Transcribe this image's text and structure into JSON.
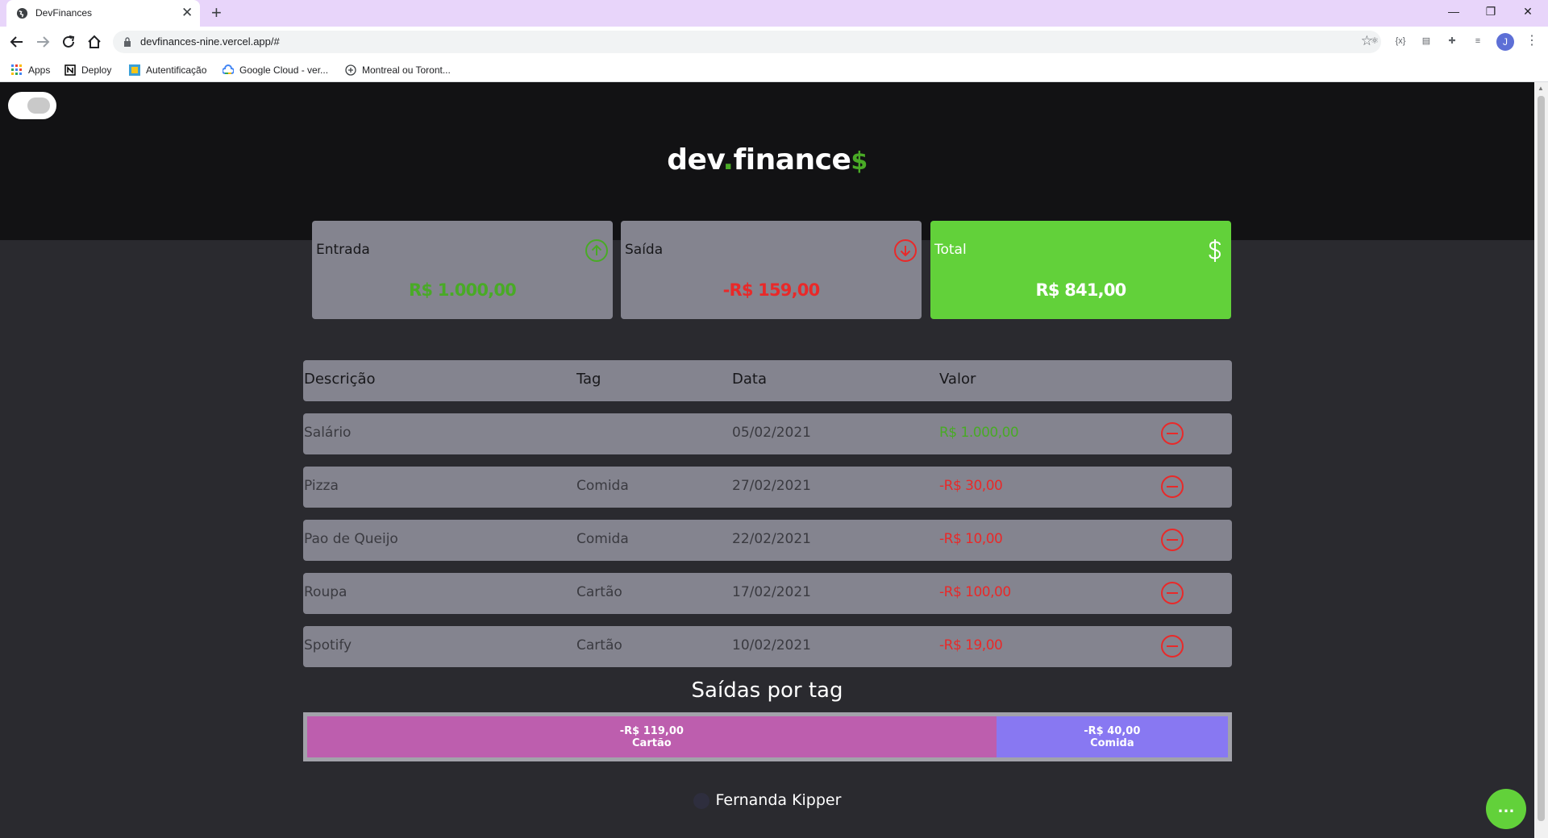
{
  "browser": {
    "tab_title": "DevFinances",
    "url": "devfinances-nine.vercel.app/#",
    "profile_initial": "J",
    "bookmarks": [
      {
        "label": "Apps",
        "icon": "apps-grid-icon"
      },
      {
        "label": "Deploy",
        "icon": "notion-icon"
      },
      {
        "label": "Autentificação",
        "icon": "bookmark-image-icon"
      },
      {
        "label": "Google Cloud - ver...",
        "icon": "google-cloud-icon"
      },
      {
        "label": "Montreal ou Toront...",
        "icon": "globe-plus-icon"
      }
    ]
  },
  "header": {
    "logo_main": "dev",
    "logo_dot": ".",
    "logo_rest": "finance",
    "logo_dollar": "$"
  },
  "cards": [
    {
      "label": "Entrada",
      "value": "R$ 1.000,00",
      "icon": "arrow-up-circle-icon",
      "value_color": "#49aa26"
    },
    {
      "label": "Saída",
      "value": "-R$ 159,00",
      "icon": "arrow-down-circle-icon",
      "value_color": "#e92929"
    },
    {
      "label": "Total",
      "value": "R$ 841,00",
      "icon": "dollar-icon",
      "value_color": "#ffffff"
    }
  ],
  "table": {
    "headers": [
      "Descrição",
      "Tag",
      "Data",
      "Valor"
    ],
    "rows": [
      {
        "description": "Salário",
        "tag": "",
        "date": "05/02/2021",
        "amount": "R$ 1.000,00",
        "kind": "income"
      },
      {
        "description": "Pizza",
        "tag": "Comida",
        "date": "27/02/2021",
        "amount": "-R$ 30,00",
        "kind": "expense"
      },
      {
        "description": "Pao de Queijo",
        "tag": "Comida",
        "date": "22/02/2021",
        "amount": "-R$ 10,00",
        "kind": "expense"
      },
      {
        "description": "Roupa",
        "tag": "Cartão",
        "date": "17/02/2021",
        "amount": "-R$ 100,00",
        "kind": "expense"
      },
      {
        "description": "Spotify",
        "tag": "Cartão",
        "date": "10/02/2021",
        "amount": "-R$ 19,00",
        "kind": "expense"
      }
    ]
  },
  "tag_summary": {
    "title": "Saídas por tag",
    "segments": [
      {
        "amount": "-R$ 119,00",
        "tag": "Cartão",
        "color": "#bd5eae",
        "share": 119
      },
      {
        "amount": "-R$ 40,00",
        "tag": "Comida",
        "color": "#8878f2",
        "share": 40
      }
    ]
  },
  "footer": {
    "author": "Fernanda Kipper"
  },
  "colors": {
    "income": "#49aa26",
    "expense": "#e92929",
    "accent": "#62d13a"
  }
}
